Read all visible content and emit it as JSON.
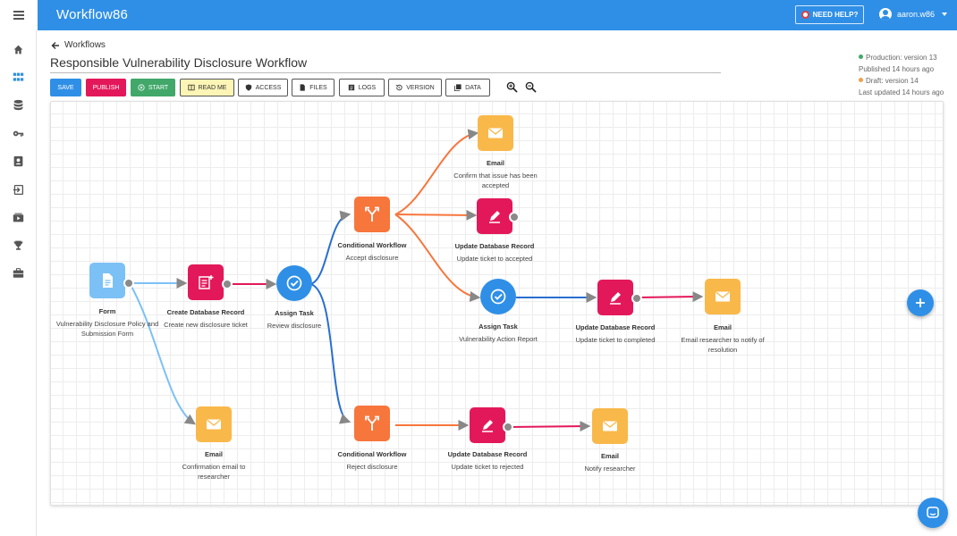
{
  "app": {
    "title": "Workflow86"
  },
  "header": {
    "help_label": "NEED HELP?",
    "user_name": "aaron.w86"
  },
  "nav": {
    "back_label": "Workflows"
  },
  "page": {
    "title": "Responsible Vulnerability Disclosure Workflow"
  },
  "status": {
    "production": "Production: version 13",
    "published": "Published 14 hours ago",
    "draft": "Draft: version 14",
    "updated": "Last updated 14 hours ago"
  },
  "toolbar": {
    "save": "SAVE",
    "publish": "PUBLISH",
    "start": "START",
    "readme": "READ ME",
    "access": "ACCESS",
    "files": "FILES",
    "logs": "LOGS",
    "version": "VERSION",
    "data": "DATA"
  },
  "nodes": {
    "form": {
      "title": "Form",
      "sub": "Vulnerability Disclosure Policy and Submission Form"
    },
    "create_db": {
      "title": "Create Database Record",
      "sub": "Create new disclosure ticket"
    },
    "assign1": {
      "title": "Assign Task",
      "sub": "Review disclosure"
    },
    "cond_accept": {
      "title": "Conditional Workflow",
      "sub": "Accept disclosure"
    },
    "email_confirm": {
      "title": "Email",
      "sub": "Confirm that issue has been accepted"
    },
    "update_accepted": {
      "title": "Update Database Record",
      "sub": "Update ticket to accepted"
    },
    "assign2": {
      "title": "Assign Task",
      "sub": "Vulnerability Action Report"
    },
    "update_completed": {
      "title": "Update Database Record",
      "sub": "Update ticket to completed"
    },
    "email_resolution": {
      "title": "Email",
      "sub": "Email researcher to notify of resolution"
    },
    "email_researcher": {
      "title": "Email",
      "sub": "Confirmation email to researcher"
    },
    "cond_reject": {
      "title": "Conditional Workflow",
      "sub": "Reject disclosure"
    },
    "update_rejected": {
      "title": "Update Database Record",
      "sub": "Update ticket to rejected"
    },
    "email_notify": {
      "title": "Email",
      "sub": "Notify researcher"
    }
  },
  "colors": {
    "primary": "#2f8fe6",
    "form": "#7cc1f5",
    "database": "#e3185a",
    "task": "#2f8fe6",
    "conditional": "#f7763c",
    "email": "#f9b84a",
    "production_dot": "#41a869",
    "draft_dot": "#f0a04a"
  }
}
